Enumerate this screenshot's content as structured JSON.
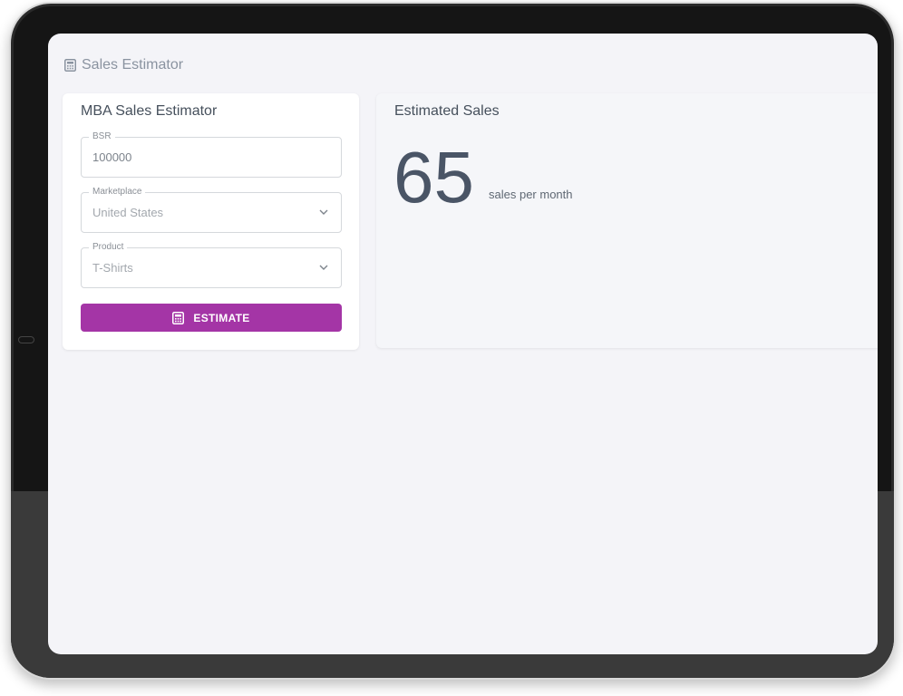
{
  "app": {
    "title": "Sales Estimator",
    "icon": "calculator-icon"
  },
  "form": {
    "title": "MBA Sales Estimator",
    "bsr": {
      "label": "BSR",
      "value": "100000"
    },
    "marketplace": {
      "label": "Marketplace",
      "value": "United States"
    },
    "product": {
      "label": "Product",
      "value": "T-Shirts"
    },
    "estimate_button": {
      "label": "ESTIMATE",
      "icon": "calculator-icon"
    }
  },
  "result": {
    "title": "Estimated Sales",
    "value": "65",
    "unit": "sales per month"
  },
  "colors": {
    "accent": "#a435a6",
    "text_dark": "#46505c",
    "background": "#f4f4f8"
  }
}
